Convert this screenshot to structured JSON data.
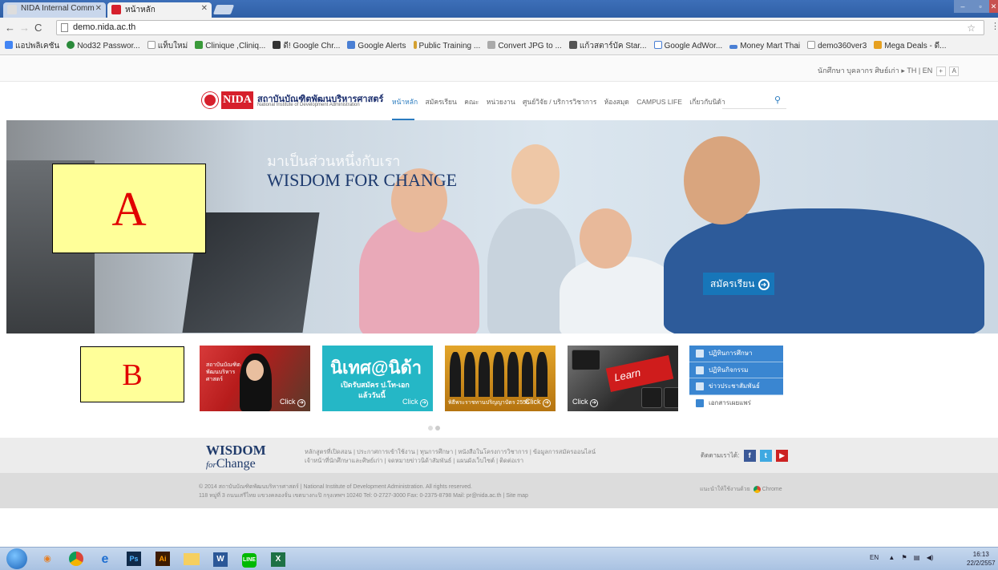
{
  "browser": {
    "tabs": [
      {
        "title": "NIDA Internal Comm",
        "active": false
      },
      {
        "title": "หน้าหลัก",
        "active": true
      }
    ],
    "url": "demo.nida.ac.th",
    "bookmarks": [
      {
        "label": "แอปพลิเคชัน",
        "color": "#4285f4"
      },
      {
        "label": "Nod32 Passwor...",
        "color": "#2a8a3a"
      },
      {
        "label": "แท็บใหม่",
        "color": "#dddddd"
      },
      {
        "label": "Clinique ,Cliniq...",
        "color": "#3a9a3a"
      },
      {
        "label": "ดี! Google Chr...",
        "color": "#333333"
      },
      {
        "label": "Google Alerts",
        "color": "#4a7fd4"
      },
      {
        "label": "Public Training ...",
        "color": "#d4a030"
      },
      {
        "label": "Convert JPG to ...",
        "color": "#888888"
      },
      {
        "label": "แก้วสตาร์บัค Star...",
        "color": "#555555"
      },
      {
        "label": "Google AdWor...",
        "color": "#4a7fd4"
      },
      {
        "label": "Money Mart Thai",
        "color": "#4a7fd4"
      },
      {
        "label": "demo360ver3",
        "color": "#dddddd"
      },
      {
        "label": "Mega Deals - ดี...",
        "color": "#e6a020"
      }
    ]
  },
  "site": {
    "toplinks": "นักศึกษา บุคลากร ศิษย์เก่า ▸ TH | EN",
    "font_buttons": [
      "+",
      "A"
    ],
    "logo_mark": "NIDA",
    "name_th": "สถาบันบัณฑิตพัฒนบริหารศาสตร์",
    "name_en": "National Institute of Development Administration",
    "nav": [
      {
        "label": "หน้าหลัก",
        "active": true
      },
      {
        "label": "สมัครเรียน",
        "active": false
      },
      {
        "label": "คณะ",
        "active": false
      },
      {
        "label": "หน่วยงาน",
        "active": false
      },
      {
        "label": "ศูนย์วิจัย / บริการวิชาการ",
        "active": false
      },
      {
        "label": "ห้องสมุด",
        "active": false
      },
      {
        "label": "CAMPUS LIFE",
        "active": false
      },
      {
        "label": "เกี่ยวกับนิด้า",
        "active": false
      }
    ],
    "search_icon": "search-icon"
  },
  "hero": {
    "tagline": "มาเป็นส่วนหนึ่งกับเรา",
    "title": "WISDOM FOR CHANGE",
    "apply_label": "สมัครเรียน"
  },
  "annotations": {
    "a": "A",
    "b": "B"
  },
  "tiles": {
    "click_label": "Click",
    "t1_text": "สถาบันบัณฑิต พัฒนบริหาร ศาสตร์",
    "t2_big": "นิเทศ@นิด้า",
    "t2_line1": "เปิดรับสมัคร ป.โท-เอก",
    "t2_line2": "แล้ววันนี้",
    "t3_caption": "พิธีพระราชทานปริญญาบัตร 2556",
    "t4_key": "Learn"
  },
  "side_menu": [
    {
      "label": "ปฏิทินการศึกษา",
      "style": "blue"
    },
    {
      "label": "ปฏิทินกิจกรรม",
      "style": "blue"
    },
    {
      "label": "ข่าวประชาสัมพันธ์",
      "style": "blue"
    },
    {
      "label": "เอกสารเผยแพร่",
      "style": "white"
    }
  ],
  "footer": {
    "wisdom": "WISDOM",
    "for": "for",
    "change": "Change",
    "links1": "หลักสูตรที่เปิดสอน | ประกาศการเข้าใช้งาน | ทุนการศึกษา | หนังสือในโครงการวิชาการ | ข้อมูลการสมัครออนไลน์",
    "links2": "เจ้าหน้าที่นักศึกษาและศิษย์เก่า | จดหมายข่าวนิด้าสัมพันธ์ | แผนผังเว็บไซต์ | ติดต่อเรา",
    "follow": "ติดตามเราได้:",
    "copyright": "© 2014 สถาบันบัณฑิตพัฒนบริหารศาสตร์ | National Institute of Development Administration. All rights reserved.",
    "address": "118 หมู่ที่ 3 ถนนเสรีไทย แขวงคลองจั่น เขตบางกะปิ กรุงเทพฯ 10240  Tel: 0-2727-3000 Fax: 0-2375-8798 Mail: pr@nida.ac.th | Site map",
    "recommend": "แนะนำให้ใช้งานด้วย",
    "browser": "Chrome"
  },
  "taskbar": {
    "apps": [
      "Windows",
      "Media",
      "Chrome",
      "Internet Explorer",
      "Photoshop",
      "Illustrator",
      "Explorer",
      "Word",
      "LINE",
      "Excel"
    ],
    "lang": "EN",
    "time": "16:13",
    "date": "22/2/2557"
  },
  "colors": {
    "nida_red": "#d6202c",
    "nida_navy": "#1c2f6e",
    "accent_blue": "#1776b9"
  }
}
